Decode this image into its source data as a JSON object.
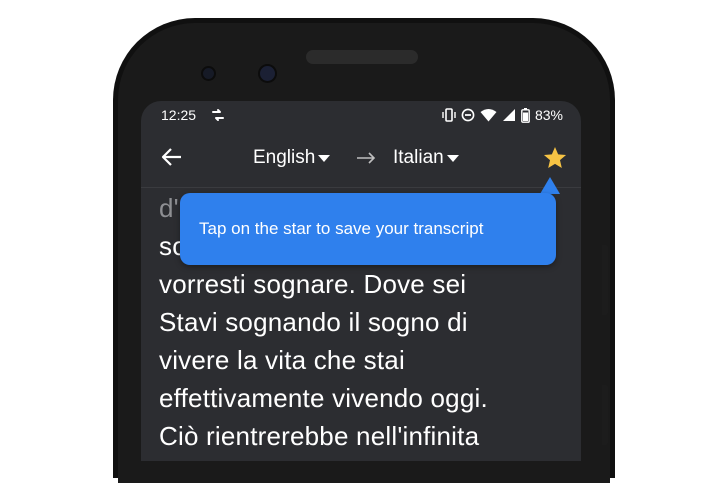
{
  "status_bar": {
    "time": "12:25",
    "battery": "83%"
  },
  "app_bar": {
    "source_language": "English",
    "target_language": "Italian"
  },
  "tooltip": {
    "text": "Tap on the star to save your transcript"
  },
  "transcript": {
    "lines": [
      "d'",
      "so",
      "vorresti sognare. Dove sei",
      "Stavi sognando il sogno di",
      "vivere la vita che stai",
      "effettivamente vivendo oggi.",
      "Ciò rientrerebbe nell'infinita"
    ]
  },
  "colors": {
    "screen_background": "#2c2d31",
    "tooltip_background": "#2f80ed",
    "star": "#f6c344"
  }
}
